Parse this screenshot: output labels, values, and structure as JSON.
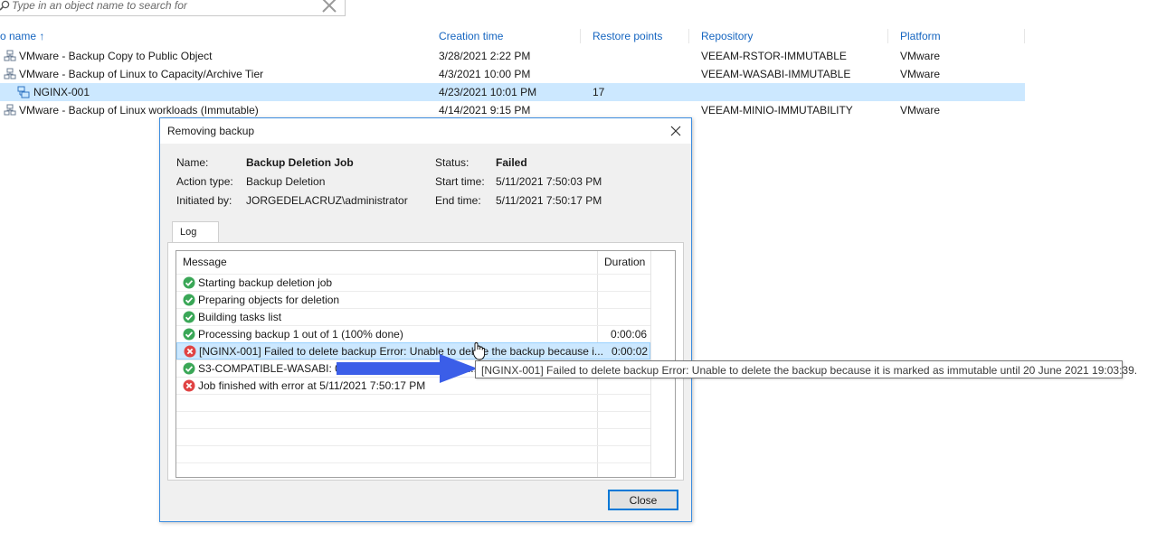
{
  "search": {
    "placeholder": "Type in an object name to search for"
  },
  "grid": {
    "columns": {
      "name": "o name",
      "sort_indicator": "↑",
      "creation_time": "Creation time",
      "restore_points": "Restore points",
      "repository": "Repository",
      "platform": "Platform"
    },
    "rows": [
      {
        "name": "VMware - Backup Copy to Public Object",
        "creation_time": "3/28/2021 2:22 PM",
        "restore_points": "",
        "repository": "VEEAM-RSTOR-IMMUTABLE",
        "platform": "VMware",
        "icon": "backup-job-icon"
      },
      {
        "name": "VMware - Backup of Linux to Capacity/Archive Tier",
        "creation_time": "4/3/2021 10:00 PM",
        "restore_points": "",
        "repository": "VEEAM-WASABI-IMMUTABLE",
        "platform": "VMware",
        "icon": "backup-job-icon"
      },
      {
        "name": "NGINX-001",
        "creation_time": "4/23/2021 10:01 PM",
        "restore_points": "17",
        "repository": "",
        "platform": "",
        "icon": "vm-icon"
      },
      {
        "name": "VMware - Backup of Linux workloads (Immutable)",
        "creation_time": "4/14/2021 9:15 PM",
        "restore_points": "",
        "repository": "VEEAM-MINIO-IMMUTABILITY",
        "platform": "VMware",
        "icon": "backup-job-icon"
      }
    ]
  },
  "dialog": {
    "title": "Removing backup",
    "labels": {
      "name": "Name:",
      "action_type": "Action type:",
      "initiated_by": "Initiated by:",
      "status": "Status:",
      "start_time": "Start time:",
      "end_time": "End time:"
    },
    "values": {
      "name": "Backup Deletion Job",
      "action_type": "Backup Deletion",
      "initiated_by": "JORGEDELACRUZ\\administrator",
      "status": "Failed",
      "start_time": "5/11/2021 7:50:03 PM",
      "end_time": "5/11/2021 7:50:17 PM"
    },
    "tab_label": "Log",
    "log_headers": {
      "message": "Message",
      "duration": "Duration"
    },
    "log_rows": [
      {
        "status": "success",
        "message": "Starting backup deletion job",
        "duration": ""
      },
      {
        "status": "success",
        "message": "Preparing objects for deletion",
        "duration": ""
      },
      {
        "status": "success",
        "message": "Building tasks list",
        "duration": ""
      },
      {
        "status": "success",
        "message": "Processing backup 1 out of 1 (100% done)",
        "duration": "0:00:06"
      },
      {
        "status": "error",
        "message": "[NGINX-001] Failed to delete backup Error: Unable to delete the backup because i...",
        "duration": "0:00:02"
      },
      {
        "status": "success",
        "message": "S3-COMPATIBLE-WASABI: 0 deleted, 0 skipped, 0 warn... failed",
        "duration": ""
      },
      {
        "status": "error",
        "message": "Job finished with error at 5/11/2021 7:50:17 PM",
        "duration": ""
      }
    ],
    "close_label": "Close"
  },
  "tooltip": {
    "text": "[NGINX-001] Failed to delete backup Error: Unable to delete the backup because it is marked as immutable until 20 June 2021 19:03:39."
  },
  "colors": {
    "accent": "#1565c0",
    "selected": "#cce8ff",
    "success": "#3aa757",
    "error": "#e04343",
    "arrow": "#3b5ee8"
  }
}
